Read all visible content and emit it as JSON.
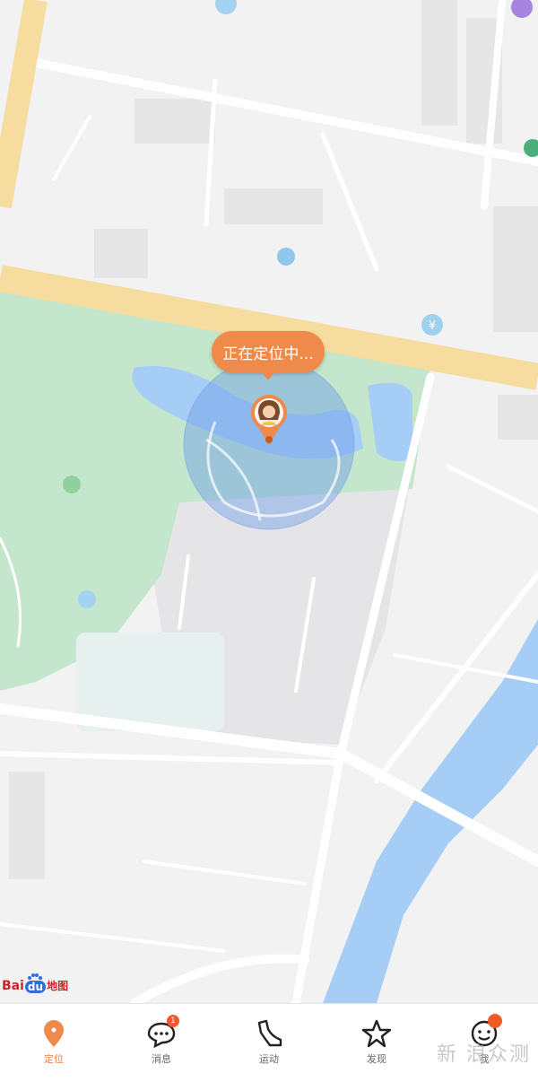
{
  "map": {
    "status_bubble": "正在定位中...",
    "logo": {
      "text_a": "Bai",
      "text_b": "du",
      "text_c": "地图"
    },
    "colors": {
      "land": "#f2f2f2",
      "park": "#c4e6cc",
      "water": "#a6cdf5",
      "main_road": "#f7dca0",
      "accuracy": "#6f9de8",
      "accent": "#ef8a4a"
    }
  },
  "tabbar": {
    "tabs": [
      {
        "label": "定位",
        "icon": "location-pin-icon",
        "active": true
      },
      {
        "label": "消息",
        "icon": "chat-bubble-icon",
        "badge": "1"
      },
      {
        "label": "运动",
        "icon": "shoe-icon"
      },
      {
        "label": "发现",
        "icon": "star-icon"
      },
      {
        "label": "我",
        "icon": "smiley-face-icon",
        "badge_dot": true
      }
    ]
  },
  "watermark": "新 浪众测"
}
